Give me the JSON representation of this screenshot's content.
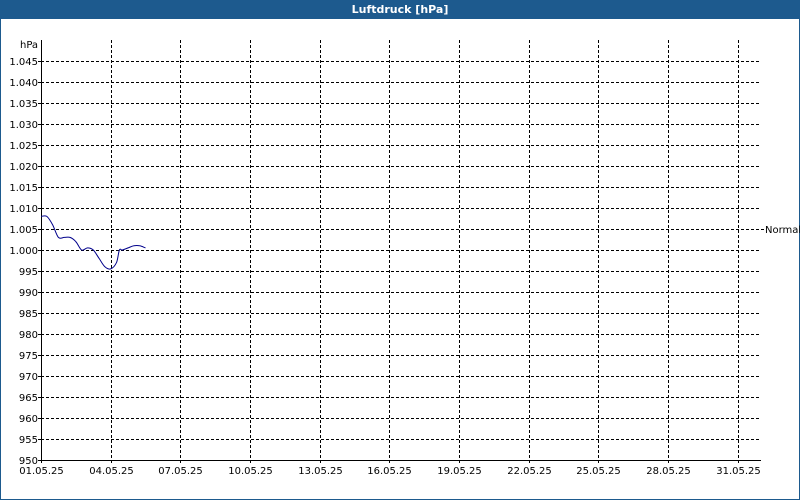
{
  "title": "Luftdruck [hPa]",
  "chart_data": {
    "type": "line",
    "title": "Luftdruck [hPa]",
    "ylabel": "hPa",
    "xlabel": "",
    "ylim": [
      950,
      1050
    ],
    "yticks": [
      950,
      955,
      960,
      965,
      970,
      975,
      980,
      985,
      990,
      995,
      1000,
      1005,
      1010,
      1015,
      1020,
      1025,
      1030,
      1035,
      1040,
      1045
    ],
    "ytick_labels": [
      "950",
      "955",
      "960",
      "965",
      "970",
      "975",
      "980",
      "985",
      "990",
      "995",
      "1.000",
      "1.005",
      "1.010",
      "1.015",
      "1.020",
      "1.025",
      "1.030",
      "1.035",
      "1.040",
      "1.045"
    ],
    "xlim": [
      "01.05.25",
      "01.06.25"
    ],
    "xticks": [
      "01.05.25",
      "04.05.25",
      "07.05.25",
      "10.05.25",
      "13.05.25",
      "16.05.25",
      "19.05.25",
      "22.05.25",
      "25.05.25",
      "28.05.25",
      "31.05.25"
    ],
    "grid": true,
    "line_color": "#00008b",
    "reference_line": {
      "label": "Normal",
      "value": 1005
    },
    "series": [
      {
        "x": [
          "01.05.25 00:00",
          "01.05.25 06:00",
          "01.05.25 12:00",
          "01.05.25 18:00",
          "02.05.25 00:00",
          "02.05.25 06:00",
          "02.05.25 12:00",
          "02.05.25 18:00",
          "03.05.25 00:00",
          "03.05.25 06:00",
          "03.05.25 12:00",
          "03.05.25 18:00",
          "04.05.25 00:00",
          "04.05.25 06:00",
          "04.05.25 09:00",
          "04.05.25 12:00",
          "04.05.25 18:00",
          "05.05.25 00:00",
          "05.05.25 06:00",
          "05.05.25 12:00"
        ],
        "values": [
          1008,
          1008,
          1006,
          1003,
          1003,
          1003,
          1002,
          1000,
          1000.5,
          1000,
          998,
          996,
          995.5,
          997,
          1000,
          1000,
          1000.5,
          1001,
          1001,
          1000.5
        ]
      }
    ]
  }
}
